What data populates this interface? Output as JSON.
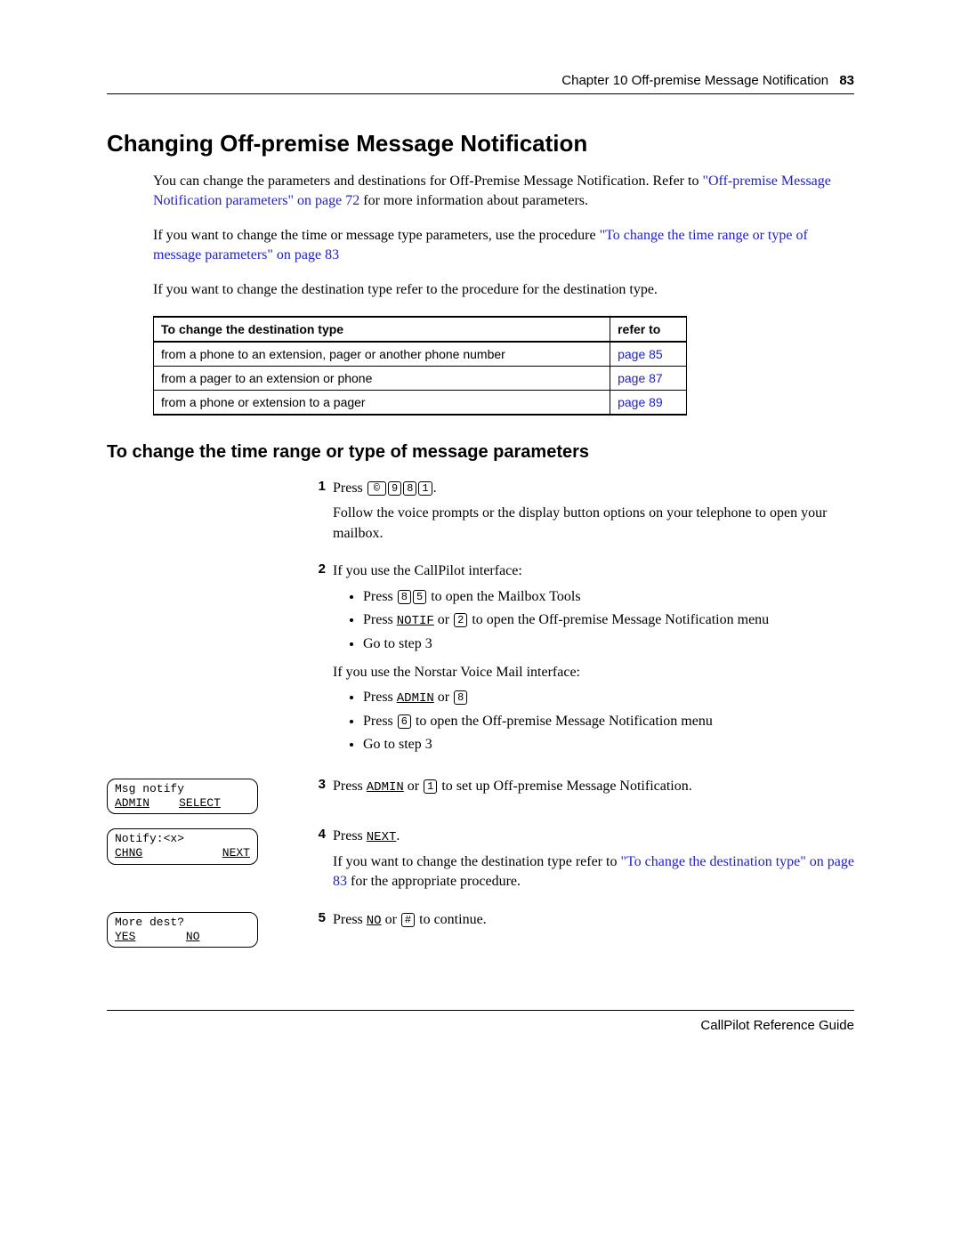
{
  "header": {
    "chapter": "Chapter 10  Off-premise Message Notification",
    "pagenum": "83"
  },
  "h1": "Changing Off-premise Message Notification",
  "p1_a": "You can change the parameters and destinations for Off-Premise Message Notification. Refer to ",
  "p1_link": "\"Off-premise Message Notification parameters\" on page 72",
  "p1_b": " for more information about parameters.",
  "p2_a": "If you want to change the time or message type parameters, use the procedure ",
  "p2_link": "\"To change the time range or type of message parameters\" on page 83",
  "p3": "If you want to change the destination type refer to the procedure for the destination type.",
  "table": {
    "h1": "To change the destination type",
    "h2": "refer to",
    "rows": [
      {
        "desc": "from a phone to an extension, pager or another phone number",
        "ref": "page 85"
      },
      {
        "desc": "from a pager to an extension or phone",
        "ref": "page 87"
      },
      {
        "desc": "from a phone or extension to a pager",
        "ref": "page 89"
      }
    ]
  },
  "h2": "To change the time range or type of message parameters",
  "steps": {
    "s1": {
      "num": "1",
      "press": "Press ",
      "keys": [
        "©",
        "9",
        "8",
        "1"
      ],
      "dot": ".",
      "follow": "Follow the voice prompts or the display button options on your telephone to open your mailbox."
    },
    "s2": {
      "num": "2",
      "intro": "If you use the CallPilot interface:",
      "b1_a": "Press ",
      "b1_k": [
        "8",
        "5"
      ],
      "b1_b": " to open the Mailbox Tools",
      "b2_a": "Press ",
      "b2_sk": "NOTIF",
      "b2_mid": " or ",
      "b2_k": [
        "2"
      ],
      "b2_b": " to open the Off-premise Message Notification menu",
      "b3": "Go to step 3",
      "intro2": "If you use the Norstar Voice Mail interface:",
      "c1_a": "Press ",
      "c1_sk": "ADMIN",
      "c1_mid": " or ",
      "c1_k": [
        "8"
      ],
      "c2_a": "Press ",
      "c2_k": [
        "6"
      ],
      "c2_b": " to open the Off-premise Message Notification menu",
      "c3": "Go to step 3"
    },
    "s3": {
      "num": "3",
      "a": "Press ",
      "sk": "ADMIN",
      "mid": " or ",
      "k": [
        "1"
      ],
      "b": " to set up Off-premise Message Notification."
    },
    "s4": {
      "num": "4",
      "a": "Press ",
      "sk": "NEXT",
      "dot": ".",
      "p2a": "If you want to change the destination type refer to ",
      "link": "\"To change the destination type\" on page 83",
      "p2b": " for the appropriate procedure."
    },
    "s5": {
      "num": "5",
      "a": "Press ",
      "sk": "NO",
      "mid": " or ",
      "k": [
        "#"
      ],
      "b": " to continue."
    }
  },
  "displays": {
    "d3": {
      "line1": "Msg notify",
      "sk1": "ADMIN",
      "sk2": "SELECT",
      "sk3": ""
    },
    "d4": {
      "line1": "Notify:<x>",
      "sk1": "CHNG",
      "sk2": "",
      "sk3": "NEXT"
    },
    "d5": {
      "line1": "More dest?",
      "sk1": "YES",
      "sk2": "NO",
      "sk3": ""
    }
  },
  "footer": "CallPilot Reference Guide"
}
